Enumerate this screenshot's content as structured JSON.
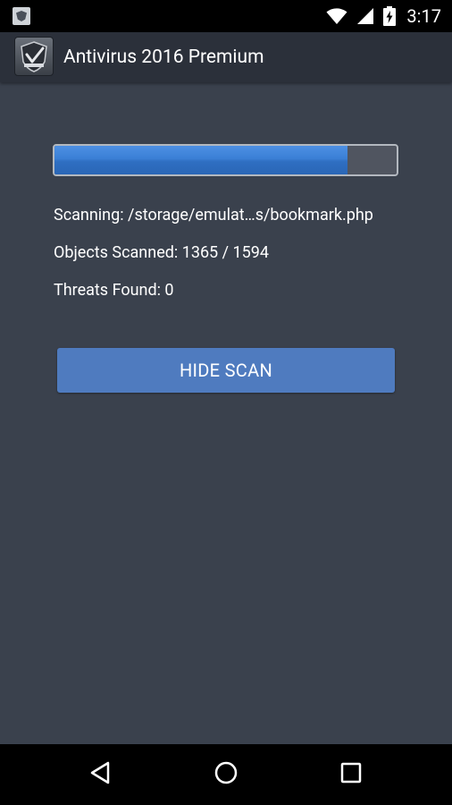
{
  "status_bar": {
    "time": "3:17",
    "icons": [
      "app-notification-icon",
      "wifi-icon",
      "signal-icon",
      "battery-charging-icon"
    ]
  },
  "app_bar": {
    "title": "Antivirus 2016 Premium",
    "logo_icon": "shield-logo-icon"
  },
  "scan": {
    "progress": 0.856,
    "scanning_text": "Scanning: /storage/emulat…s/bookmark.php",
    "objects_scanned_text": "Objects Scanned: 1365 / 1594",
    "threats_found_text": "Threats Found: 0",
    "hide_scan_label": "HIDE SCAN"
  },
  "nav_bar": {
    "icons": [
      "back-icon",
      "home-icon",
      "recents-icon"
    ]
  },
  "colors": {
    "background": "#3a414d",
    "app_bar": "#2b303a",
    "progress_fill": "#3a7fd5",
    "button": "#4f7bbf"
  }
}
